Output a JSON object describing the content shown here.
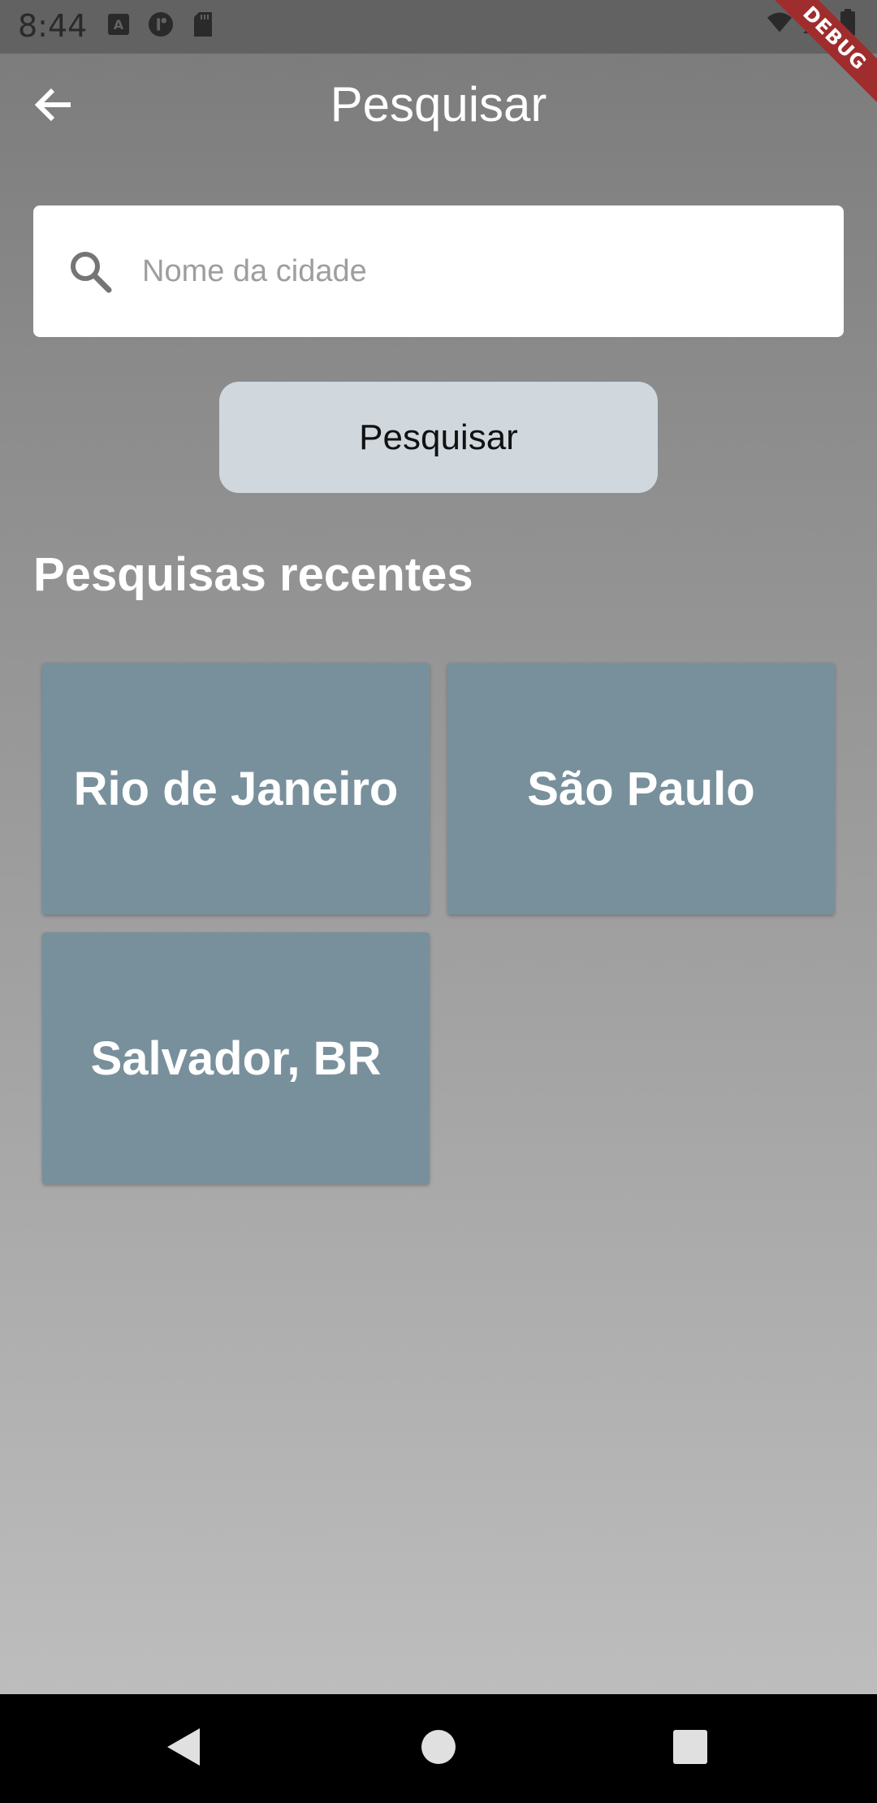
{
  "status_bar": {
    "time": "8:44",
    "icons": [
      "a-notification-icon",
      "circle-app-icon",
      "sd-card-icon",
      "wifi-icon",
      "signal-icon",
      "battery-icon"
    ]
  },
  "debug_banner": "DEBUG",
  "app_bar": {
    "back_icon": "arrow-back-icon",
    "title": "Pesquisar"
  },
  "search": {
    "placeholder": "Nome da cidade",
    "value": "",
    "icon": "search-icon"
  },
  "search_button": {
    "label": "Pesquisar"
  },
  "recent": {
    "title": "Pesquisas recentes",
    "cities": [
      {
        "name": "Rio de Janeiro"
      },
      {
        "name": "São Paulo"
      },
      {
        "name": "Salvador, BR"
      }
    ]
  },
  "colors": {
    "card_bg": "#78909c",
    "button_bg": "#d0d8de",
    "debug_banner": "#a02d2d"
  },
  "nav": {
    "icons": [
      "back-triangle-icon",
      "home-circle-icon",
      "recents-square-icon"
    ]
  }
}
